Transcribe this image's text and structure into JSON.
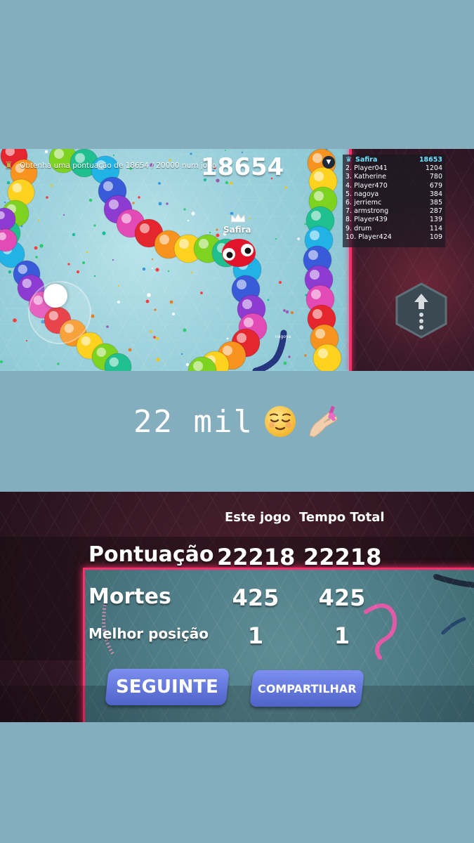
{
  "game": {
    "objective": "Obtenha uma pontuação de 18654 / 20000 num jogo",
    "score": "18654",
    "player_name": "Safira",
    "other_player_name": "nagoya",
    "leaderboard": [
      {
        "rank": "",
        "name": "Safira",
        "score": "18653"
      },
      {
        "rank": "2.",
        "name": "Player041",
        "score": "1204"
      },
      {
        "rank": "3.",
        "name": "Katherine",
        "score": "780"
      },
      {
        "rank": "4.",
        "name": "Player470",
        "score": "679"
      },
      {
        "rank": "5.",
        "name": "nagoya",
        "score": "384"
      },
      {
        "rank": "6.",
        "name": "jerriemc",
        "score": "385"
      },
      {
        "rank": "7.",
        "name": "armstrong",
        "score": "287"
      },
      {
        "rank": "8.",
        "name": "Player439",
        "score": "139"
      },
      {
        "rank": "9.",
        "name": "drum",
        "score": "114"
      },
      {
        "rank": "10.",
        "name": "Player424",
        "score": "109"
      }
    ],
    "icons": {
      "objective": "trophy-icon",
      "crown": "crown-icon",
      "joystick": "joystick-icon",
      "boost": "arrow-up-icon",
      "collapse": "chevron-down-icon"
    }
  },
  "caption": {
    "text": "22 mil",
    "emojis": [
      "relieved-face-icon",
      "nail-polish-icon"
    ]
  },
  "results": {
    "col_this_game": "Este jogo",
    "col_total": "Tempo Total",
    "rows": [
      {
        "label": "Pontuação",
        "this_game": "22218",
        "total": "22218"
      },
      {
        "label": "Mortes",
        "this_game": "425",
        "total": "425"
      },
      {
        "label": "Melhor posição",
        "this_game": "1",
        "total": "1"
      }
    ],
    "next_button": "SEGUINTE",
    "share_button": "COMPARTILHAR"
  },
  "colors": {
    "background": "#84aebd",
    "border_red": "#ff2d6a",
    "leaderboard_highlight": "#6ee3ff",
    "button_blue": "#5c70d6"
  }
}
